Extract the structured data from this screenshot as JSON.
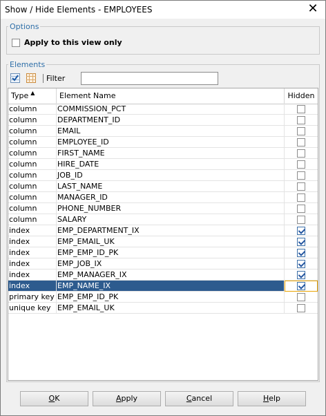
{
  "window": {
    "title": "Show / Hide Elements - EMPLOYEES"
  },
  "options": {
    "legend": "Options",
    "apply_label": "Apply to this view only",
    "apply_checked": false
  },
  "elements": {
    "legend": "Elements",
    "filter_label": "Filter",
    "filter_value": "",
    "columns": {
      "type": "Type",
      "name": "Element Name",
      "hidden": "Hidden"
    },
    "rows": [
      {
        "type": "column",
        "name": "COMMISSION_PCT",
        "hidden": false
      },
      {
        "type": "column",
        "name": "DEPARTMENT_ID",
        "hidden": false
      },
      {
        "type": "column",
        "name": "EMAIL",
        "hidden": false
      },
      {
        "type": "column",
        "name": "EMPLOYEE_ID",
        "hidden": false
      },
      {
        "type": "column",
        "name": "FIRST_NAME",
        "hidden": false
      },
      {
        "type": "column",
        "name": "HIRE_DATE",
        "hidden": false
      },
      {
        "type": "column",
        "name": "JOB_ID",
        "hidden": false
      },
      {
        "type": "column",
        "name": "LAST_NAME",
        "hidden": false
      },
      {
        "type": "column",
        "name": "MANAGER_ID",
        "hidden": false
      },
      {
        "type": "column",
        "name": "PHONE_NUMBER",
        "hidden": false
      },
      {
        "type": "column",
        "name": "SALARY",
        "hidden": false
      },
      {
        "type": "index",
        "name": "EMP_DEPARTMENT_IX",
        "hidden": true
      },
      {
        "type": "index",
        "name": "EMP_EMAIL_UK",
        "hidden": true
      },
      {
        "type": "index",
        "name": "EMP_EMP_ID_PK",
        "hidden": true
      },
      {
        "type": "index",
        "name": "EMP_JOB_IX",
        "hidden": true
      },
      {
        "type": "index",
        "name": "EMP_MANAGER_IX",
        "hidden": true
      },
      {
        "type": "index",
        "name": "EMP_NAME_IX",
        "hidden": true,
        "selected": true
      },
      {
        "type": "primary key",
        "name": "EMP_EMP_ID_PK",
        "hidden": false
      },
      {
        "type": "unique key",
        "name": "EMP_EMAIL_UK",
        "hidden": false
      }
    ]
  },
  "buttons": {
    "ok": {
      "mnemonic": "O",
      "rest": "K"
    },
    "apply": {
      "mnemonic": "A",
      "rest": "pply"
    },
    "cancel": {
      "mnemonic": "C",
      "rest": "ancel"
    },
    "help": {
      "mnemonic": "H",
      "rest": "elp"
    }
  },
  "icons": {
    "check_all": "check-all-icon",
    "uncheck_all": "uncheck-all-icon",
    "sort": "sort-ascending-icon",
    "close": "close-icon"
  },
  "colors": {
    "accent": "#2f6fa8",
    "selection": "#2d5b8e",
    "focus": "#e8a200"
  }
}
